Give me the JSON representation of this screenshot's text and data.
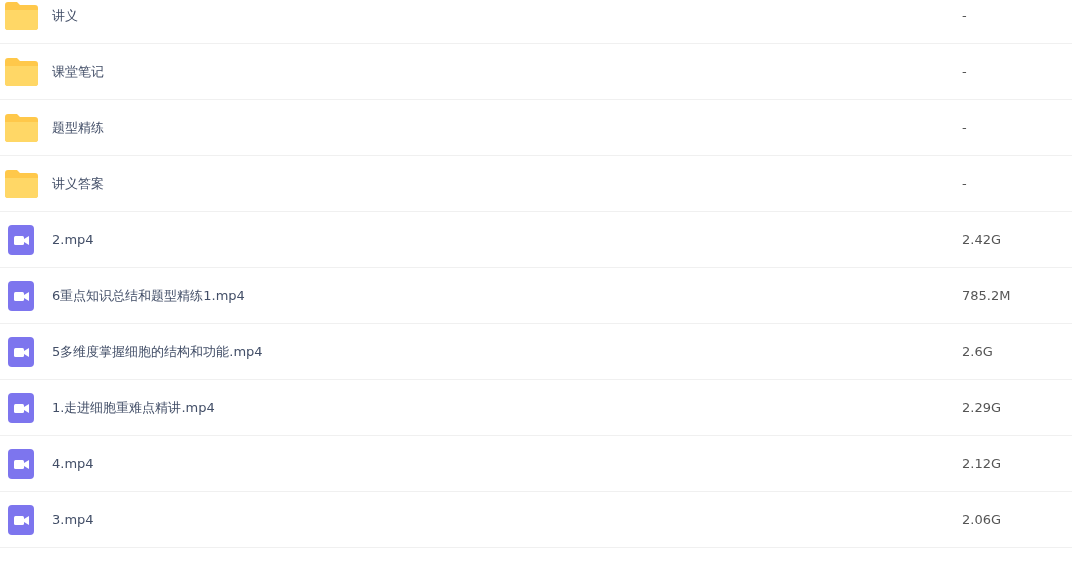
{
  "files": [
    {
      "kind": "folder",
      "name": "讲义",
      "size": "-"
    },
    {
      "kind": "folder",
      "name": "课堂笔记",
      "size": "-"
    },
    {
      "kind": "folder",
      "name": "题型精练",
      "size": "-"
    },
    {
      "kind": "folder",
      "name": "讲义答案",
      "size": "-"
    },
    {
      "kind": "video",
      "name": "2.mp4",
      "size": "2.42G"
    },
    {
      "kind": "video",
      "name": "6重点知识总结和题型精练1.mp4",
      "size": "785.2M"
    },
    {
      "kind": "video",
      "name": "5多维度掌握细胞的结构和功能.mp4",
      "size": "2.6G"
    },
    {
      "kind": "video",
      "name": "1.走进细胞重难点精讲.mp4",
      "size": "2.29G"
    },
    {
      "kind": "video",
      "name": "4.mp4",
      "size": "2.12G"
    },
    {
      "kind": "video",
      "name": "3.mp4",
      "size": "2.06G"
    }
  ]
}
